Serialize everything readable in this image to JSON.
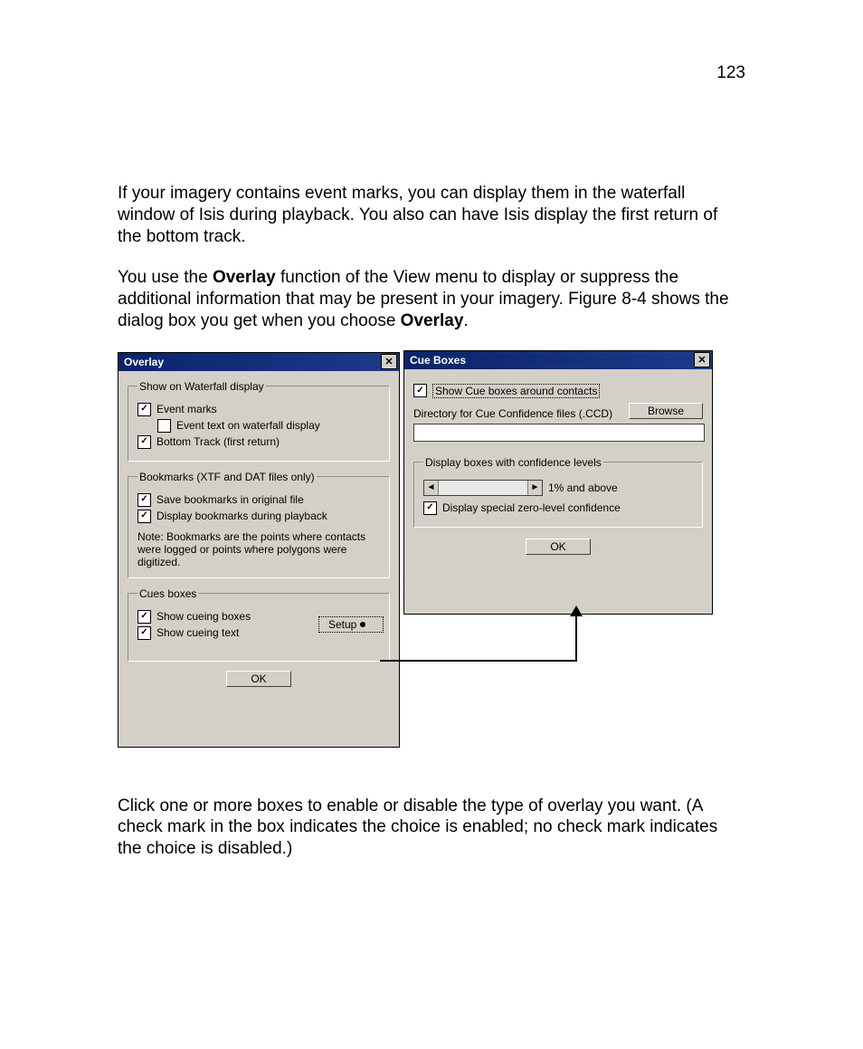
{
  "page_number": "123",
  "para1": "If your imagery contains event marks, you can display them in the waterfall window of Isis during playback. You also can have Isis display the first return of the bottom track.",
  "para2a": "You use the ",
  "para2b_bold": "Overlay",
  "para2c": " function of the View menu to display or suppress the additional information that may be present in your imagery. Figure 8-4 shows the dialog box you get when you choose ",
  "para2d_bold": "Overlay",
  "para2e": ".",
  "para3": "Click one or more boxes to enable or disable the type of overlay you want. (A check mark in the box indicates the choice is enabled; no check mark indicates the choice is disabled.)",
  "overlay_dialog": {
    "title": "Overlay",
    "group1": {
      "legend": "Show on Waterfall display",
      "event_marks": "Event marks",
      "event_text": "Event text on waterfall display",
      "bottom_track": "Bottom Track (first return)"
    },
    "group2": {
      "legend": "Bookmarks (XTF and DAT files only)",
      "save_bm": "Save bookmarks in original file",
      "display_bm": "Display bookmarks during playback",
      "note": "Note: Bookmarks are the points where contacts were logged or points where polygons were digitized."
    },
    "group3": {
      "legend": "Cues boxes",
      "show_cue_boxes": "Show cueing boxes",
      "show_cue_text": "Show cueing text",
      "setup": "Setup"
    },
    "ok": "OK"
  },
  "cue_dialog": {
    "title": "Cue Boxes",
    "show_cue": "Show Cue boxes around contacts",
    "dir_label": "Directory for Cue Confidence files (.CCD)",
    "browse": "Browse",
    "group": {
      "legend": "Display boxes with confidence levels",
      "slider_label": "1% and above",
      "zero_level": "Display special zero-level confidence"
    },
    "ok": "OK"
  },
  "checkmark": "✓",
  "close_glyph": "✕",
  "left_arrow": "◄",
  "right_arrow": "►"
}
